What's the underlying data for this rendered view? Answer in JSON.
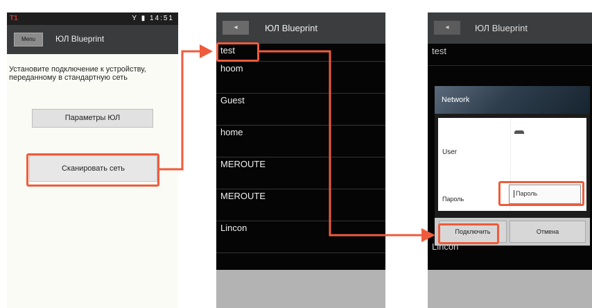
{
  "colors": {
    "annotation": "#ef5b3b"
  },
  "phone1": {
    "status": {
      "left": "T1",
      "right": "Y ▮ 14:51"
    },
    "menu_button": "Menu",
    "title": "ЮЛ Blueprint",
    "hint": "Установите подключение к устройству, переданному в стандартную сеть",
    "settings_button": "Параметры ЮЛ",
    "connect_button": "Сканировать сеть"
  },
  "phone2": {
    "back_button": "◂",
    "title": "ЮЛ Blueprint",
    "items": [
      "test",
      "hoom",
      "Guest",
      "home",
      "MEROUTE",
      "MEROUTE",
      "Lincon"
    ]
  },
  "phone3": {
    "back_button": "◂",
    "title": "ЮЛ Blueprint",
    "bg_items": [
      "test",
      "Lincon"
    ],
    "dialog": {
      "title": "Network",
      "user_label": "User",
      "password_label": "Пароль",
      "password_placeholder": "Пароль",
      "ok": "Подключить",
      "cancel": "Отмена"
    }
  }
}
